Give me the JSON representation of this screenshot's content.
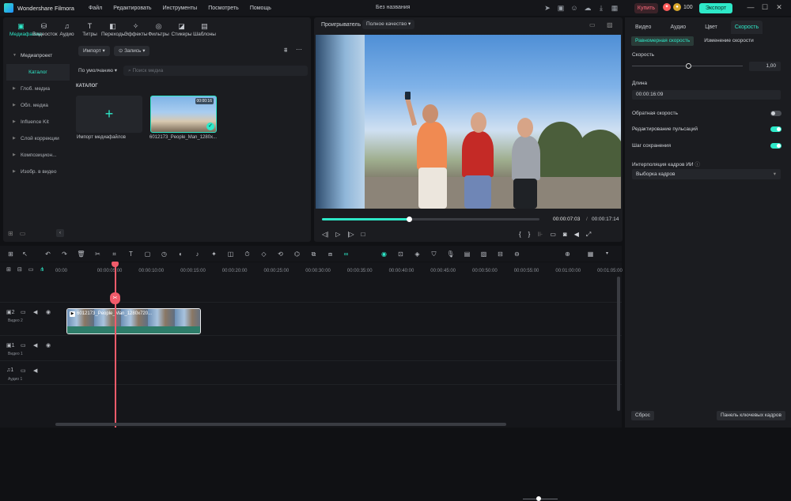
{
  "app": {
    "name": "Wondershare Filmora",
    "project_title": "Без названия"
  },
  "menu": [
    "Файл",
    "Редактировать",
    "Инструменты",
    "Посмотреть",
    "Помощь"
  ],
  "topbar": {
    "buy_label": "Купить",
    "credits": "100",
    "export_label": "Экспорт"
  },
  "media_tabs": [
    "Медиафайлы",
    "Видеосток",
    "Аудио",
    "Титры",
    "Переходы",
    "Эффекты",
    "Фильтры",
    "Стикеры",
    "Шаблоны"
  ],
  "sidebar": {
    "header": "Медиапроект",
    "selected": "Каталог",
    "items": [
      "Глоб. медиа",
      "Обл. медиа",
      "Influence Kit",
      "Слой коррекции",
      "Композицион...",
      "Изобр. в видео"
    ]
  },
  "media_toolbar": {
    "import_label": "Импорт",
    "record_label": "Запись"
  },
  "media_filter": {
    "sort_label": "По умолчанию",
    "search_placeholder": "Поиск медиа"
  },
  "catalog": {
    "label": "КАТАЛОГ",
    "import_card_label": "Импорт медиафайлов",
    "video_card_label": "6012173_People_Man_1280x...",
    "video_card_duration": "00:00:16"
  },
  "player": {
    "label": "Проигрыватель",
    "quality": "Полное качество",
    "current_time": "00:00:07:03",
    "total_time": "00:00:17:14",
    "progress": 0.4
  },
  "props": {
    "tabs": [
      "Видео",
      "Аудио",
      "Цвет",
      "Скорость"
    ],
    "active_tab": "Скорость",
    "subtabs": [
      "Равномерная скорость",
      "Изменение скорости"
    ],
    "speed_label": "Скорость",
    "speed_value": "1,00",
    "duration_label": "Длина",
    "duration_value": "00:00:16:09",
    "reverse_label": "Обратная скорость",
    "ripple_label": "Редактирование пульсаций",
    "pitch_label": "Шаг сохранения",
    "ai_interp_label": "Интерполяция кадров ИИ",
    "ai_interp_value": "Выборка кадров",
    "reset_label": "Сброс",
    "keyframe_label": "Панель ключевых кадров",
    "toggles": {
      "reverse": false,
      "ripple": true,
      "pitch": true
    }
  },
  "timeline": {
    "ruler": [
      "00:00",
      "00:00:05:00",
      "00:00:10:00",
      "00:00:15:00",
      "00:00:20:00",
      "00:00:25:00",
      "00:00:30:00",
      "00:00:35:00",
      "00:00:40:00",
      "00:00:45:00",
      "00:00:50:00",
      "00:00:55:00",
      "00:01:00:00",
      "00:01:05:00"
    ],
    "tracks": [
      {
        "num": "2",
        "label": "Видео 2"
      },
      {
        "num": "1",
        "label": "Видео 1"
      },
      {
        "num": "1",
        "label": "Аудио 1"
      }
    ],
    "clip_title": "6012173_People_Man_1280x720..."
  },
  "colors": {
    "accent": "#2ee8c8",
    "playhead": "#f05b6a",
    "buy": "#ff6b7d"
  }
}
